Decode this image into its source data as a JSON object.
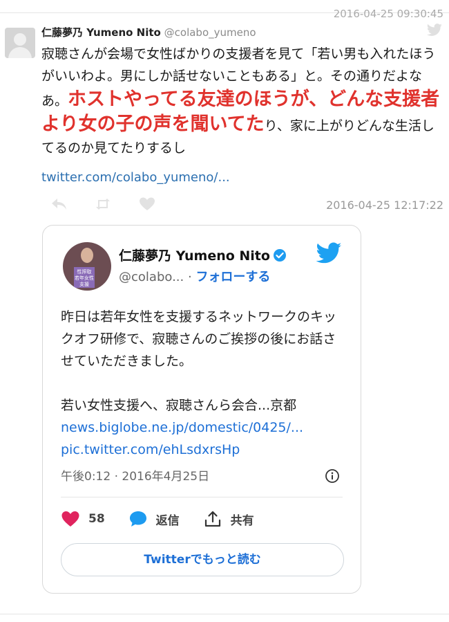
{
  "top": {
    "date_partial": "2016-04-25 09:30:45"
  },
  "tweet": {
    "author_name": "仁藤夢乃 Yumeno Nito",
    "author_handle": "@colabo_yumeno",
    "text_part1": "寂聴さんが会場で女性ばかりの支援者を見て「若い男も入れたほうがいいわよ。男にしか話せないこともある」と。その通りだよなあ。",
    "text_highlight": "ホストやってる友達のほうが、どんな支援者より女の子の声を聞いてた",
    "text_part2": "り、家に上がりどんな生活してるのか見てたりするし",
    "link": "twitter.com/colabo_yumeno/...",
    "timestamp": "2016-04-25 12:17:22"
  },
  "embed": {
    "name": "仁藤夢乃 Yumeno Nito",
    "handle": "@colabo...",
    "follow_separator": "·",
    "follow_label": "フォローする",
    "avatar_sign_text": "性搾取 若年女性 支援",
    "body_line1": "昨日は若年女性を支援するネットワークのキックオフ研修で、寂聴さんのご挨拶の後にお話させていただきました。",
    "body_line2": "若い女性支援へ、寂聴さんら会合...京都",
    "link1": "news.biglobe.ne.jp/domestic/0425/...",
    "link2": "pic.twitter.com/ehLsdxrsHp",
    "meta": "午後0:12 · 2016年4月25日",
    "likes": "58",
    "reply_label": "返信",
    "share_label": "共有",
    "read_more": "Twitterでもっと読む"
  },
  "colors": {
    "highlight_red": "#e0322d",
    "link_blue": "#1d6fd6",
    "heart_pink": "#e0245e",
    "twitter_blue": "#1da1f2"
  },
  "icons": [
    "reply-icon",
    "retweet-icon",
    "like-icon",
    "twitter-bird-icon",
    "verified-badge-icon",
    "info-icon",
    "heart-icon",
    "comment-bubble-icon",
    "share-icon"
  ]
}
